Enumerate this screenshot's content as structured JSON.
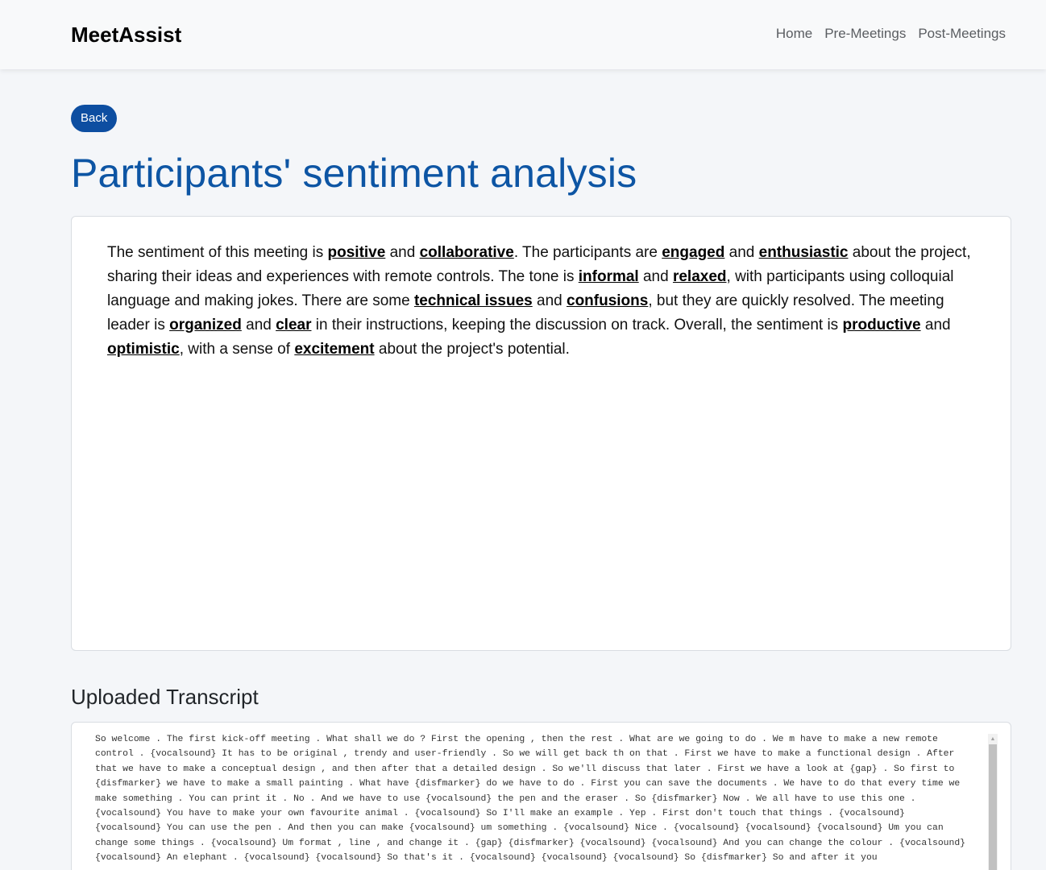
{
  "navbar": {
    "brand": "MeetAssist",
    "links": [
      "Home",
      "Pre-Meetings",
      "Post-Meetings"
    ]
  },
  "back_label": "Back",
  "page_title": "Participants' sentiment analysis",
  "sentiment": {
    "segments": [
      {
        "t": "The sentiment of this meeting is ",
        "k": false
      },
      {
        "t": "positive",
        "k": true
      },
      {
        "t": " and ",
        "k": false
      },
      {
        "t": "collaborative",
        "k": true
      },
      {
        "t": ". The participants are ",
        "k": false
      },
      {
        "t": "engaged",
        "k": true
      },
      {
        "t": " and ",
        "k": false
      },
      {
        "t": "enthusiastic",
        "k": true
      },
      {
        "t": " about the project, sharing their ideas and experiences with remote controls. The tone is ",
        "k": false
      },
      {
        "t": "informal",
        "k": true
      },
      {
        "t": " and ",
        "k": false
      },
      {
        "t": "relaxed",
        "k": true
      },
      {
        "t": ", with participants using colloquial language and making jokes. There are some ",
        "k": false
      },
      {
        "t": "technical issues",
        "k": true
      },
      {
        "t": " and ",
        "k": false
      },
      {
        "t": "confusions",
        "k": true
      },
      {
        "t": ", but they are quickly resolved. The meeting leader is ",
        "k": false
      },
      {
        "t": "organized",
        "k": true
      },
      {
        "t": " and ",
        "k": false
      },
      {
        "t": "clear",
        "k": true
      },
      {
        "t": " in their instructions, keeping the discussion on track. Overall, the sentiment is ",
        "k": false
      },
      {
        "t": "productive",
        "k": true
      },
      {
        "t": " and ",
        "k": false
      },
      {
        "t": "optimistic",
        "k": true
      },
      {
        "t": ", with a sense of ",
        "k": false
      },
      {
        "t": "excitement",
        "k": true
      },
      {
        "t": " about the project's potential.",
        "k": false
      }
    ]
  },
  "transcript": {
    "title": "Uploaded Transcript",
    "text": "So welcome . The first kick-off meeting . What shall we do ? First the opening , then the rest . What are we going to do . We m have to make a new remote control . {vocalsound} It has to be original , trendy and user-friendly . So we will get back th on that . First we have to make a functional design . After that we have to make a conceptual design , and then after that a detailed design . So we'll discuss that later . First we have a look at {gap} . So first to {disfmarker} we have to make a small painting . What have {disfmarker} do we have to do . First you can save the documents . We have to do that every time we make something . You can print it . No . And we have to use {vocalsound} the pen and the eraser . So {disfmarker} Now . We all have to use this one . {vocalsound} You have to make your own favourite animal . {vocalsound} So I'll make an example . Yep . First don't touch that things . {vocalsound} {vocalsound} You can use the pen . And then you can make {vocalsound} um something . {vocalsound} Nice . {vocalsound} {vocalsound} {vocalsound} Um you can change some things . {vocalsound} Um format , line , and change it . {gap} {disfmarker} {vocalsound} {vocalsound} And you can change the colour . {vocalsound} {vocalsound} An elephant . {vocalsound} {vocalsound} So that's it . {vocalsound} {vocalsound} {vocalsound} So {disfmarker} So and after it you"
  }
}
